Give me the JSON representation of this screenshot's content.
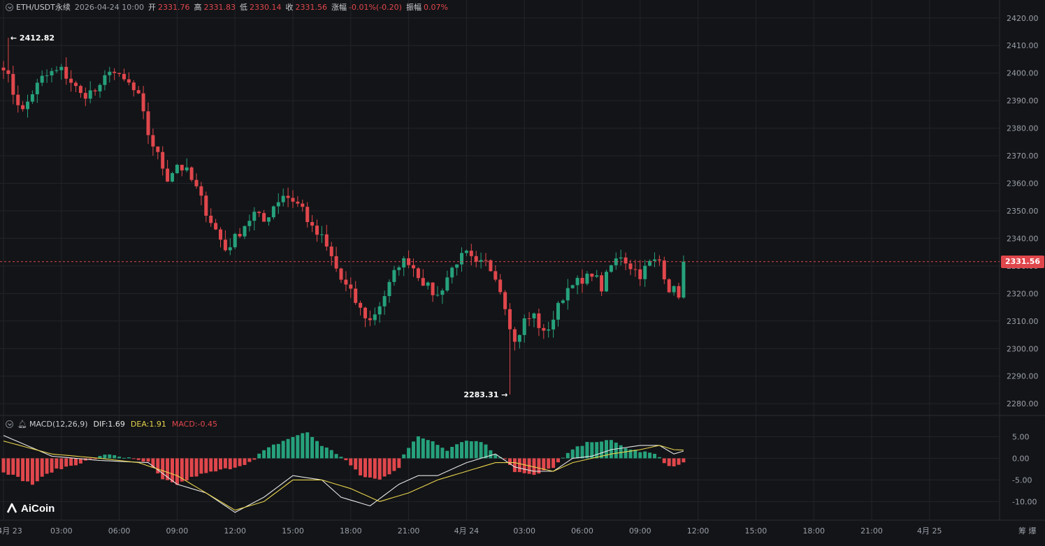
{
  "header": {
    "symbol": "ETH/USDT永续",
    "datetime": "2026-04-24 10:00",
    "open_label": "开",
    "open_value": "2331.76",
    "high_label": "高",
    "high_value": "2331.83",
    "low_label": "低",
    "low_value": "2330.14",
    "close_label": "收",
    "close_value": "2331.56",
    "change_label": "涨幅",
    "change_value": "-0.01%(-0.20)",
    "amp_label": "振幅",
    "amp_value": "0.07%"
  },
  "annotations": {
    "high_marker": "← 2412.82",
    "low_marker": "2283.31 →",
    "last_price": "2331.56"
  },
  "macd": {
    "title": "MACD(12,26,9)",
    "dif_text": "DIF:1.69",
    "dea_text": "DEA:1.91",
    "macd_text": "MACD:-0.45"
  },
  "logo_text": "AiCoin",
  "right_chips": "筹  爆",
  "colors": {
    "up": "#26a17b",
    "down": "#e0474c",
    "dif": "#e6e6e6",
    "dea": "#e8d44d",
    "bg": "#131417",
    "grid": "#22242a",
    "axis_text": "#9aa0aa"
  },
  "chart_data": [
    {
      "type": "candlestick",
      "title": "ETH/USDT永续",
      "price_ticks": [
        "2420.00",
        "2410.00",
        "2400.00",
        "2390.00",
        "2380.00",
        "2370.00",
        "2360.00",
        "2350.00",
        "2340.00",
        "2330.00",
        "2320.00",
        "2310.00",
        "2300.00",
        "2290.00",
        "2280.00"
      ],
      "ylim": [
        2277,
        2424
      ],
      "time_ticks": [
        "4月 23",
        "03:00",
        "06:00",
        "09:00",
        "12:00",
        "15:00",
        "18:00",
        "21:00",
        "4月 24",
        "03:00",
        "06:00",
        "09:00",
        "12:00",
        "15:00",
        "18:00",
        "21:00",
        "4月 25"
      ],
      "time_tick_index": [
        0,
        12,
        24,
        36,
        48,
        60,
        72,
        84,
        96,
        108,
        120,
        132,
        144,
        156,
        168,
        180,
        192
      ],
      "last_price": 2331.56,
      "series_high": 2412.82,
      "series_low": 2283.31,
      "close_anchors": [
        [
          0,
          2403
        ],
        [
          2,
          2393
        ],
        [
          4,
          2386
        ],
        [
          6,
          2393
        ],
        [
          8,
          2398
        ],
        [
          10,
          2400
        ],
        [
          12,
          2401
        ],
        [
          14,
          2397
        ],
        [
          16,
          2392
        ],
        [
          18,
          2393
        ],
        [
          20,
          2394
        ],
        [
          22,
          2402
        ],
        [
          24,
          2398
        ],
        [
          26,
          2396
        ],
        [
          28,
          2391
        ],
        [
          30,
          2378
        ],
        [
          32,
          2370
        ],
        [
          34,
          2362
        ],
        [
          36,
          2367
        ],
        [
          38,
          2364
        ],
        [
          40,
          2358
        ],
        [
          42,
          2350
        ],
        [
          44,
          2343
        ],
        [
          46,
          2336
        ],
        [
          48,
          2340
        ],
        [
          50,
          2345
        ],
        [
          52,
          2349
        ],
        [
          54,
          2346
        ],
        [
          56,
          2352
        ],
        [
          58,
          2356
        ],
        [
          60,
          2354
        ],
        [
          62,
          2351
        ],
        [
          64,
          2343
        ],
        [
          66,
          2340
        ],
        [
          68,
          2333
        ],
        [
          70,
          2325
        ],
        [
          72,
          2320
        ],
        [
          74,
          2314
        ],
        [
          76,
          2310
        ],
        [
          78,
          2316
        ],
        [
          80,
          2323
        ],
        [
          82,
          2331
        ],
        [
          84,
          2332
        ],
        [
          86,
          2327
        ],
        [
          88,
          2322
        ],
        [
          90,
          2319
        ],
        [
          92,
          2326
        ],
        [
          94,
          2332
        ],
        [
          96,
          2334
        ],
        [
          98,
          2330
        ],
        [
          100,
          2331
        ],
        [
          102,
          2327
        ],
        [
          104,
          2316
        ],
        [
          106,
          2302
        ],
        [
          108,
          2310
        ],
        [
          110,
          2312
        ],
        [
          112,
          2305
        ],
        [
          114,
          2311
        ],
        [
          116,
          2319
        ],
        [
          118,
          2325
        ],
        [
          120,
          2323
        ],
        [
          122,
          2328
        ],
        [
          124,
          2322
        ],
        [
          126,
          2330
        ],
        [
          128,
          2334
        ],
        [
          130,
          2330
        ],
        [
          132,
          2327
        ],
        [
          134,
          2331
        ],
        [
          136,
          2332
        ],
        [
          138,
          2322
        ],
        [
          140,
          2320
        ],
        [
          141,
          2331.56
        ]
      ]
    },
    {
      "type": "bar",
      "title": "MACD(12,26,9)",
      "y_ticks": [
        "5.00",
        "0.00",
        "-5.00",
        "-10.00"
      ],
      "ylim": [
        -13.5,
        7.5
      ],
      "dif_last": 1.69,
      "dea_last": 1.91,
      "macd_last": -0.45,
      "hist_anchors": [
        [
          0,
          -3
        ],
        [
          6,
          -6
        ],
        [
          10,
          -3
        ],
        [
          16,
          -1
        ],
        [
          22,
          1
        ],
        [
          26,
          0
        ],
        [
          30,
          -1
        ],
        [
          33,
          -5
        ],
        [
          36,
          -6
        ],
        [
          40,
          -4
        ],
        [
          44,
          -3
        ],
        [
          48,
          -2
        ],
        [
          52,
          -0.5
        ],
        [
          53,
          1
        ],
        [
          56,
          3
        ],
        [
          60,
          5
        ],
        [
          63,
          6
        ],
        [
          66,
          3
        ],
        [
          70,
          0.5
        ],
        [
          71,
          -0.5
        ],
        [
          74,
          -4
        ],
        [
          78,
          -5
        ],
        [
          82,
          -2
        ],
        [
          83,
          1
        ],
        [
          86,
          5
        ],
        [
          89,
          4
        ],
        [
          92,
          2
        ],
        [
          95,
          4
        ],
        [
          99,
          4
        ],
        [
          102,
          1
        ],
        [
          104,
          0
        ],
        [
          106,
          -3
        ],
        [
          110,
          -4
        ],
        [
          114,
          -2
        ],
        [
          116,
          0
        ],
        [
          118,
          2
        ],
        [
          122,
          4
        ],
        [
          126,
          4
        ],
        [
          130,
          2
        ],
        [
          135,
          1
        ],
        [
          137,
          -1
        ],
        [
          139,
          -2
        ],
        [
          141,
          -1
        ]
      ],
      "dif_anchors": [
        [
          0,
          5.3
        ],
        [
          10,
          0.5
        ],
        [
          20,
          -0.5
        ],
        [
          30,
          -1
        ],
        [
          36,
          -6
        ],
        [
          42,
          -8
        ],
        [
          48,
          -12.5
        ],
        [
          54,
          -9
        ],
        [
          60,
          -4
        ],
        [
          66,
          -5
        ],
        [
          70,
          -9
        ],
        [
          76,
          -11
        ],
        [
          82,
          -6
        ],
        [
          86,
          -4
        ],
        [
          90,
          -4
        ],
        [
          96,
          -1
        ],
        [
          102,
          1
        ],
        [
          106,
          -2
        ],
        [
          110,
          -3
        ],
        [
          114,
          -3
        ],
        [
          118,
          0
        ],
        [
          122,
          0.5
        ],
        [
          126,
          2
        ],
        [
          132,
          3
        ],
        [
          136,
          3
        ],
        [
          139,
          1
        ],
        [
          141,
          1.69
        ]
      ],
      "dea_anchors": [
        [
          0,
          4
        ],
        [
          10,
          1
        ],
        [
          20,
          0
        ],
        [
          28,
          -1
        ],
        [
          36,
          -4
        ],
        [
          42,
          -8
        ],
        [
          48,
          -12
        ],
        [
          54,
          -10
        ],
        [
          60,
          -5
        ],
        [
          66,
          -5
        ],
        [
          72,
          -7
        ],
        [
          78,
          -10
        ],
        [
          84,
          -8
        ],
        [
          90,
          -5
        ],
        [
          96,
          -3
        ],
        [
          102,
          -1
        ],
        [
          106,
          -1
        ],
        [
          110,
          -2
        ],
        [
          114,
          -3
        ],
        [
          118,
          -1
        ],
        [
          122,
          0
        ],
        [
          126,
          1
        ],
        [
          132,
          2
        ],
        [
          136,
          3
        ],
        [
          139,
          2
        ],
        [
          141,
          1.91
        ]
      ]
    }
  ]
}
